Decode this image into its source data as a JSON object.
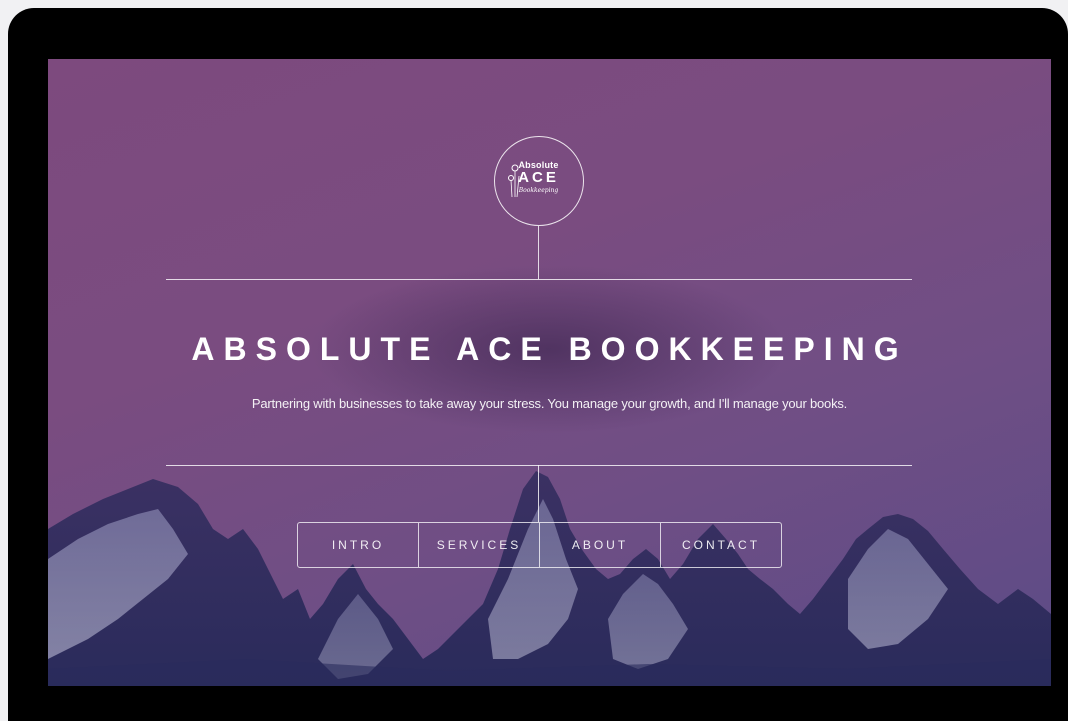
{
  "logo": {
    "line1": "Absolute",
    "line2": "ACE",
    "line3": "Bookkeeping"
  },
  "hero": {
    "title": "ABSOLUTE ACE BOOKKEEPING",
    "subtitle": "Partnering with businesses to take away your stress. You manage your growth, and I'll manage your books."
  },
  "nav": {
    "items": [
      {
        "label": "INTRO"
      },
      {
        "label": "SERVICES"
      },
      {
        "label": "ABOUT"
      },
      {
        "label": "CONTACT"
      }
    ]
  },
  "colors": {
    "background_purple": "#7a4c80",
    "mountain_dark": "#2c2a5a",
    "line_white": "#ffffff"
  }
}
